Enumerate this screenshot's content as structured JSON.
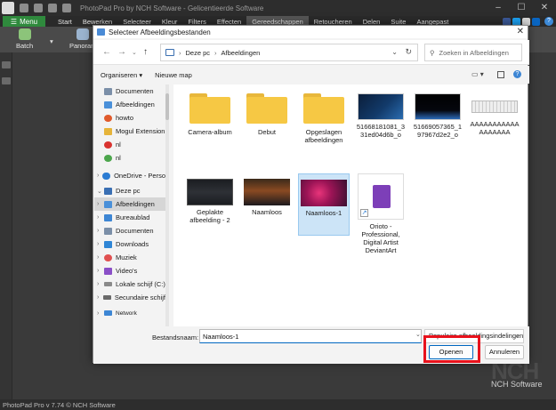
{
  "app": {
    "title": "PhotoPad Pro by NCH Software - Gelicentieerde Software",
    "menu_label": "Menu",
    "tabs": [
      "Start",
      "Bewerken",
      "Selecteer",
      "Kleur",
      "Filters",
      "Effecten",
      "Gereedschappen",
      "Retoucheren",
      "Delen",
      "Suite",
      "Aangepast"
    ],
    "active_tab": "Gereedschappen",
    "toolbar": {
      "batch": "Batch",
      "panorama": "Panoram"
    },
    "status": "PhotoPad Pro v 7.74 © NCH Software",
    "logo_text": "NCH",
    "logo_sub": "NCH Software",
    "help": "?"
  },
  "dialog": {
    "title": "Selecteer Afbeeldingsbestanden",
    "breadcrumb": [
      "Deze pc",
      "Afbeeldingen"
    ],
    "search_placeholder": "Zoeken in Afbeeldingen",
    "organize": "Organiseren",
    "new_folder": "Nieuwe map",
    "nav_items": [
      {
        "label": "Documenten",
        "pinned": true,
        "color": "#7b8fa8"
      },
      {
        "label": "Afbeeldingen",
        "pinned": true,
        "color": "#4a90d9"
      },
      {
        "label": "howto",
        "color": "#e05a2b"
      },
      {
        "label": "Mogul Extension",
        "color": "#e6b43a"
      },
      {
        "label": "nl",
        "color": "#d9332f"
      },
      {
        "label": "nl",
        "color": "#4ca64c"
      },
      {
        "label": "OneDrive - Perso",
        "color": "#2b7cd3"
      },
      {
        "label": "Deze pc",
        "color": "#3a6fb3"
      },
      {
        "label": "Afbeeldingen",
        "color": "#4a90d9"
      },
      {
        "label": "Bureaublad",
        "color": "#3d86d4"
      },
      {
        "label": "Documenten",
        "color": "#7b8fa8"
      },
      {
        "label": "Downloads",
        "color": "#2f86d6"
      },
      {
        "label": "Muziek",
        "color": "#e05050"
      },
      {
        "label": "Video's",
        "color": "#8a4fc7"
      },
      {
        "label": "Lokale schijf (C:)",
        "color": "#8a8a8a"
      },
      {
        "label": "Secundaire schijf",
        "color": "#6a6a6a"
      },
      {
        "label": "Network",
        "color": "#3d86d4"
      }
    ],
    "files": [
      {
        "name": "Camera-album",
        "kind": "folder"
      },
      {
        "name": "Debut",
        "kind": "folder"
      },
      {
        "name": "Opgeslagen afbeeldingen",
        "kind": "folder"
      },
      {
        "name": "51668181081_331ed04d6b_o",
        "kind": "image"
      },
      {
        "name": "51669057365_197967d2e2_o",
        "kind": "image"
      },
      {
        "name": "AAAAAAAAAAAAAAAAAA",
        "kind": "image"
      },
      {
        "name": "Geplakte afbeelding - 2",
        "kind": "image"
      },
      {
        "name": "Naamloos",
        "kind": "image"
      },
      {
        "name": "Naamloos-1",
        "kind": "image",
        "selected": true
      },
      {
        "name": "Orioto - Professional, Digital Artist DeviantArt",
        "kind": "shortcut"
      }
    ],
    "filename_label": "Bestandsnaam:",
    "filename_value": "Naamloos-1",
    "filetype": "Populaire afbeeldingsindelingen",
    "open_button": "Openen",
    "cancel_button": "Annuleren"
  }
}
